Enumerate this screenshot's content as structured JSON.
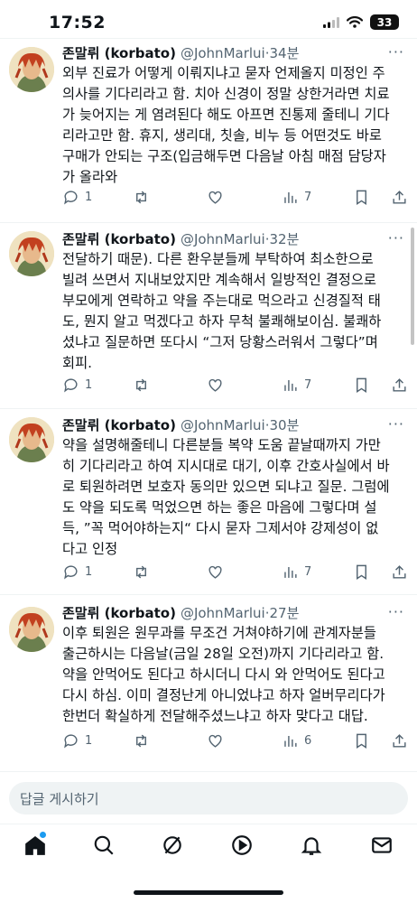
{
  "status_bar": {
    "time": "17:52",
    "battery": "33"
  },
  "tweets": [
    {
      "name": "존말뤼 (korbato)",
      "handle": "@JohnMarlui",
      "separator": "·",
      "time": "34분",
      "lines": [
        "외부 진료가 어떻게 이뤄지냐고 묻자 언제올지 미정인 주",
        "의사를 기다리라고 함. 치아 신경이 정말 상한거라면 치료",
        "가 늦어지는 게 염려된다 해도 아프면 진통제 줄테니 기다",
        "리라고만 함. 휴지, 생리대, 칫솔, 비누 등 어떤것도 바로",
        "구매가 안되는 구조(입금해두면 다음날 아침 매점 담당자",
        "가 올라와"
      ],
      "replies": "1",
      "views": "7"
    },
    {
      "name": "존말뤼 (korbato)",
      "handle": "@JohnMarlui",
      "separator": "·",
      "time": "32분",
      "lines": [
        "전달하기 때문). 다른 환우분들께 부탁하여 최소한으로",
        "빌려 쓰면서 지내보았지만 계속해서 일방적인 결정으로",
        "부모에게 연락하고 약을 주는대로 먹으라고 신경질적 태",
        "도, 뭔지 알고 먹겠다고 하자 무척 불쾌해보이심. 불쾌하",
        "셨냐고 질문하면 또다시 “그저 당황스러워서 그렇다”며",
        "회피."
      ],
      "replies": "1",
      "views": "7"
    },
    {
      "name": "존말뤼 (korbato)",
      "handle": "@JohnMarlui",
      "separator": "·",
      "time": "30분",
      "lines": [
        "약을 설명해줄테니 다른분들 복약 도움 끝날때까지 가만",
        "히 기다리라고 하여 지시대로 대기, 이후 간호사실에서 바",
        "로 퇴원하려면 보호자 동의만 있으면 되냐고 질문. 그럼에",
        "도 약을 되도록 먹었으면 하는 좋은 마음에 그렇다며 설",
        "득, ”꼭 먹어야하는지“ 다시 묻자 그제서야 강제성이 없",
        "다고 인정"
      ],
      "replies": "1",
      "views": "7"
    },
    {
      "name": "존말뤼 (korbato)",
      "handle": "@JohnMarlui",
      "separator": "·",
      "time": "27분",
      "lines": [
        "이후 퇴원은 원무과를 무조건 거쳐야하기에 관계자분들",
        "출근하시는 다음날(금일 28일 오전)까지 기다리라고 함.",
        "약을 안먹어도 된다고 하시더니 다시 와 안먹어도 된다고",
        "다시 하심. 이미 결정난게 아니었냐고 하자 얼버무리다가",
        "한번더 확실하게 전달해주셨느냐고 하자 맞다고 대답."
      ],
      "replies": "1",
      "views": "6"
    }
  ],
  "reply_placeholder": "답글 게시하기",
  "colors": {
    "text": "#0f1419",
    "muted": "#536471",
    "accent": "#1d9bf0",
    "divider": "#eff3f4"
  },
  "icons": {
    "status": [
      "signal-icon",
      "wifi-icon",
      "battery-icon"
    ],
    "actions": [
      "reply-icon",
      "retweet-icon",
      "like-icon",
      "views-icon",
      "bookmark-icon",
      "share-icon"
    ],
    "nav": [
      "home-icon",
      "search-icon",
      "grok-icon",
      "video-icon",
      "notifications-icon",
      "messages-icon"
    ]
  }
}
